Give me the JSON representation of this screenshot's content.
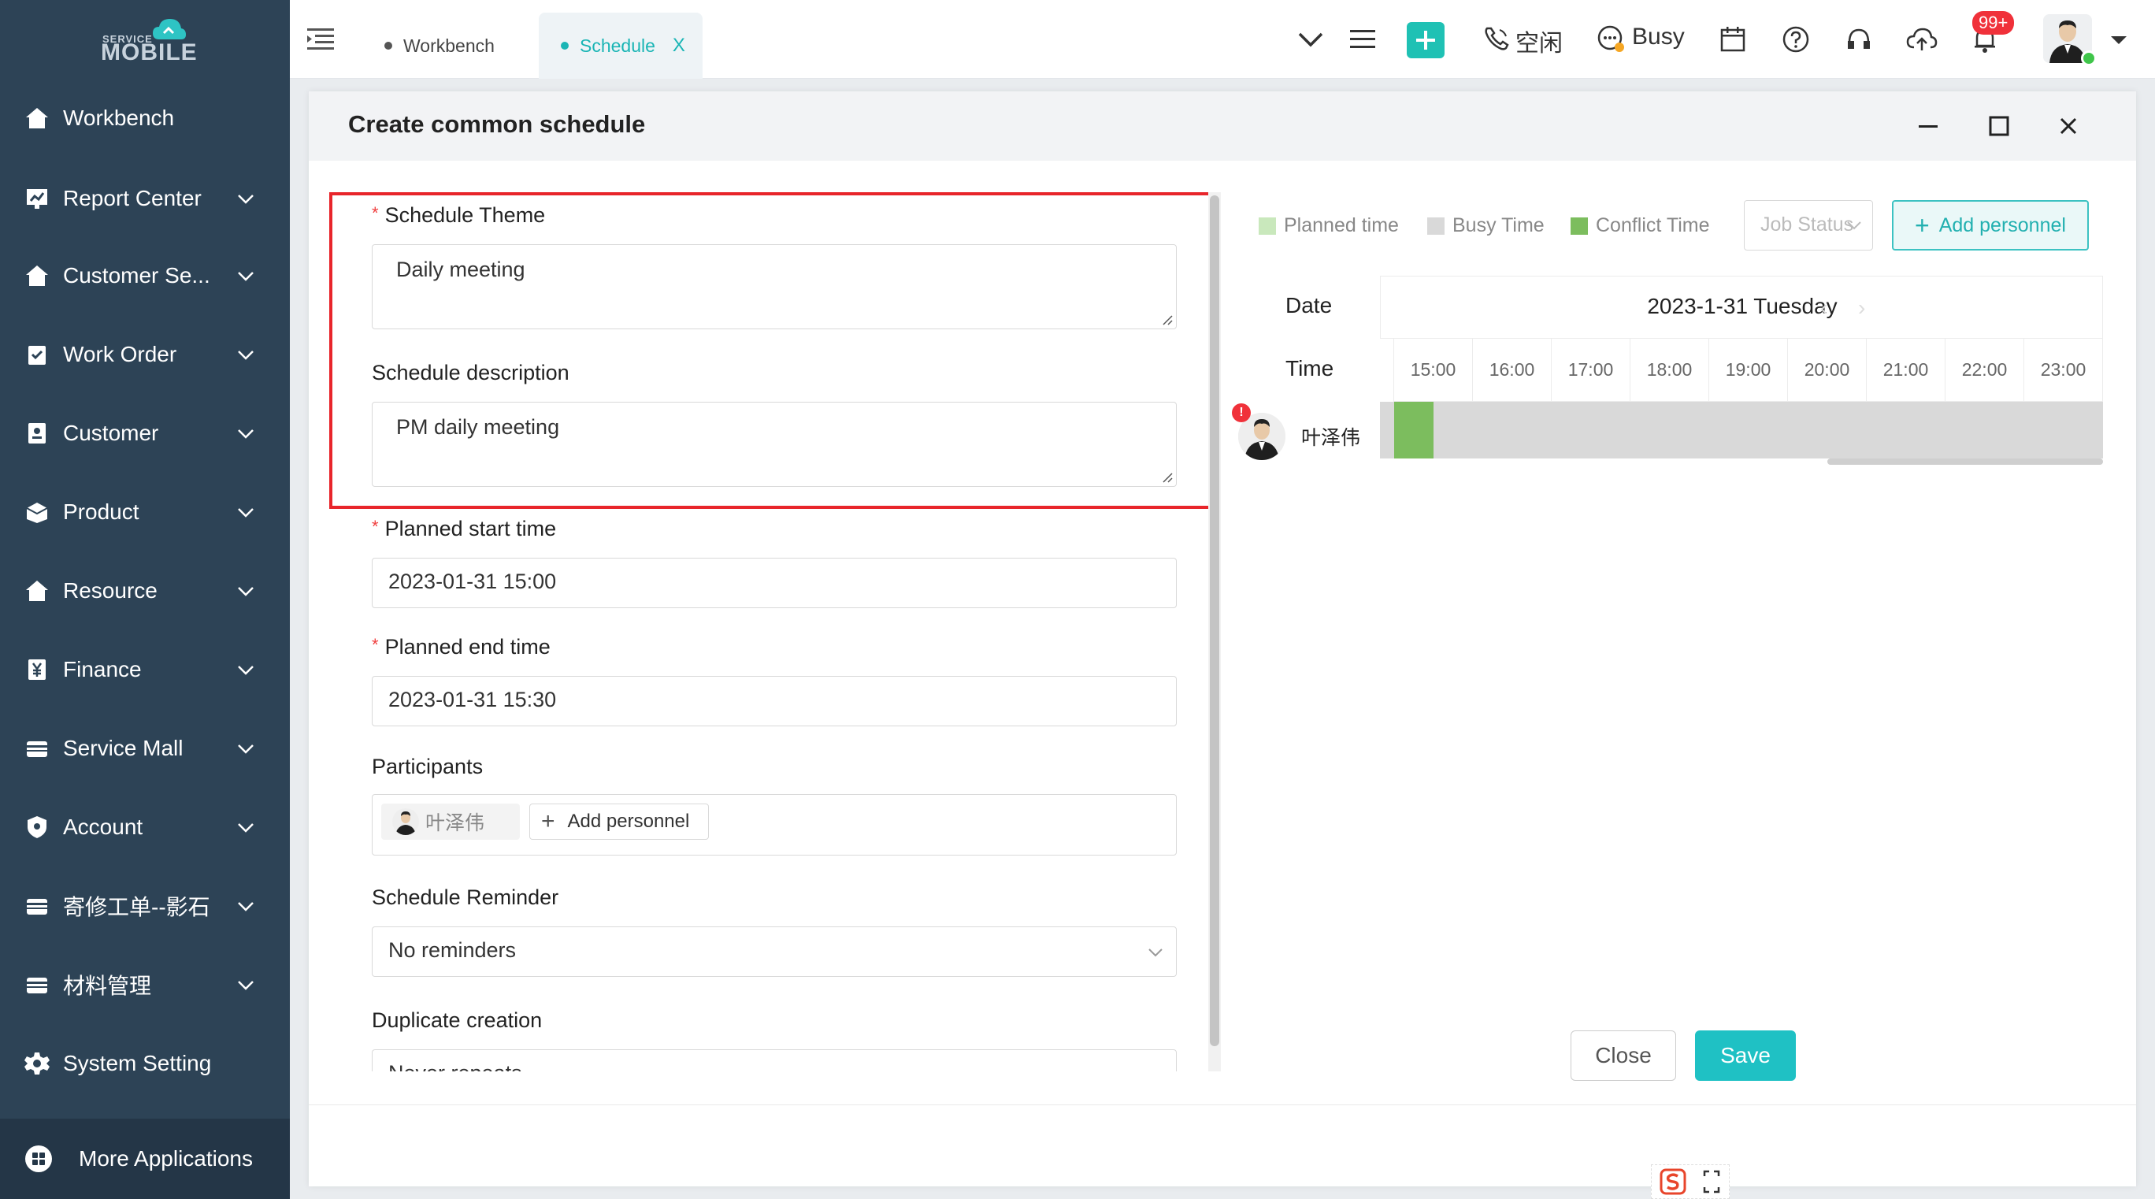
{
  "sidebar": {
    "logo": {
      "line1": "SERVICE",
      "line2": "MOBILE"
    },
    "items": [
      {
        "label": "Workbench",
        "icon": "home-icon",
        "has_children": false
      },
      {
        "label": "Report Center",
        "icon": "report-icon",
        "has_children": true
      },
      {
        "label": "Customer Se...",
        "icon": "home-icon",
        "has_children": true
      },
      {
        "label": "Work Order",
        "icon": "clipboard-icon",
        "has_children": true
      },
      {
        "label": "Customer",
        "icon": "contact-icon",
        "has_children": true
      },
      {
        "label": "Product",
        "icon": "box-icon",
        "has_children": true
      },
      {
        "label": "Resource",
        "icon": "home-icon",
        "has_children": true
      },
      {
        "label": "Finance",
        "icon": "yen-icon",
        "has_children": true
      },
      {
        "label": "Service Mall",
        "icon": "card-icon",
        "has_children": true
      },
      {
        "label": "Account",
        "icon": "shield-icon",
        "has_children": true
      },
      {
        "label": "寄修工单--影石",
        "icon": "card-icon",
        "has_children": true
      },
      {
        "label": "材料管理",
        "icon": "card-icon",
        "has_children": true
      },
      {
        "label": "System Setting",
        "icon": "gear-icon",
        "has_children": false
      }
    ],
    "more_apps": "More Applications"
  },
  "topbar": {
    "tabs": [
      {
        "label": "Workbench",
        "active": false
      },
      {
        "label": "Schedule",
        "active": true,
        "close": "X"
      }
    ],
    "status_idle": "空闲",
    "status_busy": "Busy",
    "notification_badge": "99+"
  },
  "dialog": {
    "title": "Create common schedule",
    "form": {
      "theme": {
        "label": "Schedule Theme",
        "required": "*",
        "value": "Daily meeting"
      },
      "description": {
        "label": "Schedule description",
        "value": "PM daily meeting"
      },
      "start": {
        "label": "Planned start time",
        "required": "*",
        "value": "2023-01-31 15:00"
      },
      "end": {
        "label": "Planned end time",
        "required": "*",
        "value": "2023-01-31 15:30"
      },
      "participants": {
        "label": "Participants",
        "chip": "叶泽伟",
        "add_label": "Add personnel"
      },
      "reminder": {
        "label": "Schedule Reminder",
        "value": "No reminders"
      },
      "duplicate": {
        "label": "Duplicate creation",
        "value": "Never repeats"
      }
    },
    "right": {
      "legend": [
        {
          "label": "Planned time",
          "color": "#c9e8bc"
        },
        {
          "label": "Busy Time",
          "color": "#d9d9d9"
        },
        {
          "label": "Conflict Time",
          "color": "#7cbd5e"
        }
      ],
      "job_status_placeholder": "Job Status",
      "add_personnel": "Add personnel",
      "date_label": "Date",
      "time_label": "Time",
      "date_value": "2023-1-31 Tuesday",
      "prev_arrow": "‹",
      "next_arrow": "›",
      "hours": [
        "15:00",
        "16:00",
        "17:00",
        "18:00",
        "19:00",
        "20:00",
        "21:00",
        "22:00",
        "23:00"
      ],
      "person": {
        "name": "叶泽伟",
        "alert": "!"
      }
    },
    "footer": {
      "close": "Close",
      "save": "Save"
    }
  }
}
